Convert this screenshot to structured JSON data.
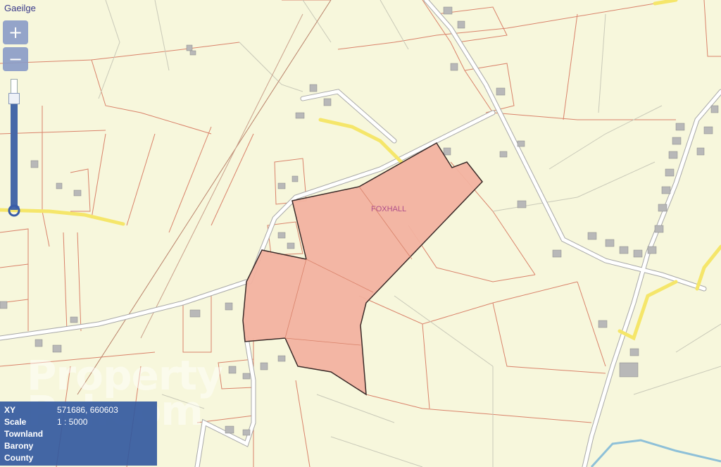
{
  "language_link": "Gaeilge",
  "zoom": {
    "in_label": "+",
    "out_label": "−",
    "level": 0.88
  },
  "map": {
    "townland_label": "FOXHALL",
    "parcel_color": "#f2b2a0",
    "boundary_color": "#d9826a",
    "road_color": "#f5e66a"
  },
  "watermark": {
    "line1": "Property",
    "line2": "Pal.com"
  },
  "info": [
    {
      "label": "XY",
      "value": "571686, 660603"
    },
    {
      "label": "Scale",
      "value": "1 : 5000"
    },
    {
      "label": "Townland",
      "value": ""
    },
    {
      "label": "Barony",
      "value": ""
    },
    {
      "label": "County",
      "value": ""
    }
  ]
}
